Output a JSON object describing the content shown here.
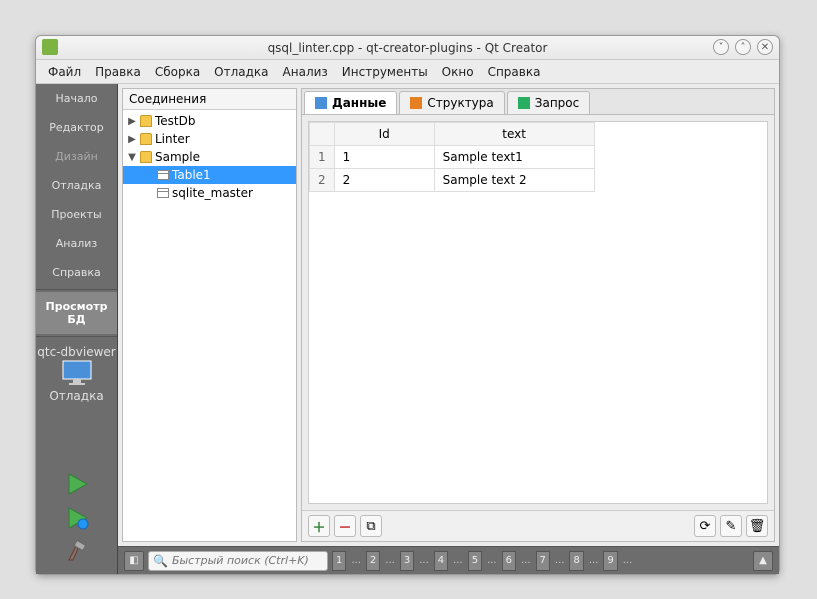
{
  "window": {
    "title": "qsql_linter.cpp - qt-creator-plugins - Qt Creator"
  },
  "menu": [
    "Файл",
    "Правка",
    "Сборка",
    "Отладка",
    "Анализ",
    "Инструменты",
    "Окно",
    "Справка"
  ],
  "leftbar": {
    "modes": [
      {
        "label": "Начало",
        "disabled": false
      },
      {
        "label": "Редактор",
        "disabled": false
      },
      {
        "label": "Дизайн",
        "disabled": true
      },
      {
        "label": "Отладка",
        "disabled": false
      },
      {
        "label": "Проекты",
        "disabled": false
      },
      {
        "label": "Анализ",
        "disabled": false
      },
      {
        "label": "Справка",
        "disabled": false
      },
      {
        "label": "Просмотр БД",
        "disabled": false,
        "active": true
      }
    ],
    "kit": "qtc-dbviewer",
    "debug_label": "Отладка"
  },
  "connections": {
    "header": "Соединения",
    "tree": [
      {
        "label": "TestDb",
        "type": "db",
        "expanded": false,
        "depth": 0
      },
      {
        "label": "Linter",
        "type": "db",
        "expanded": false,
        "depth": 0
      },
      {
        "label": "Sample",
        "type": "db",
        "expanded": true,
        "depth": 0
      },
      {
        "label": "Table1",
        "type": "table",
        "depth": 1,
        "selected": true
      },
      {
        "label": "sqlite_master",
        "type": "table",
        "depth": 1
      }
    ]
  },
  "tabs": [
    {
      "label": "Данные",
      "icon": "data",
      "active": true
    },
    {
      "label": "Структура",
      "icon": "struct"
    },
    {
      "label": "Запрос",
      "icon": "query"
    }
  ],
  "table": {
    "columns": [
      "Id",
      "text"
    ],
    "rows": [
      {
        "n": "1",
        "cells": [
          "1",
          "Sample text1"
        ]
      },
      {
        "n": "2",
        "cells": [
          "2",
          "Sample text 2"
        ]
      }
    ]
  },
  "search": {
    "placeholder": "Быстрый поиск (Ctrl+K)"
  },
  "status_numbers": [
    "1",
    "2",
    "3",
    "4",
    "5",
    "6",
    "7",
    "8",
    "9"
  ]
}
